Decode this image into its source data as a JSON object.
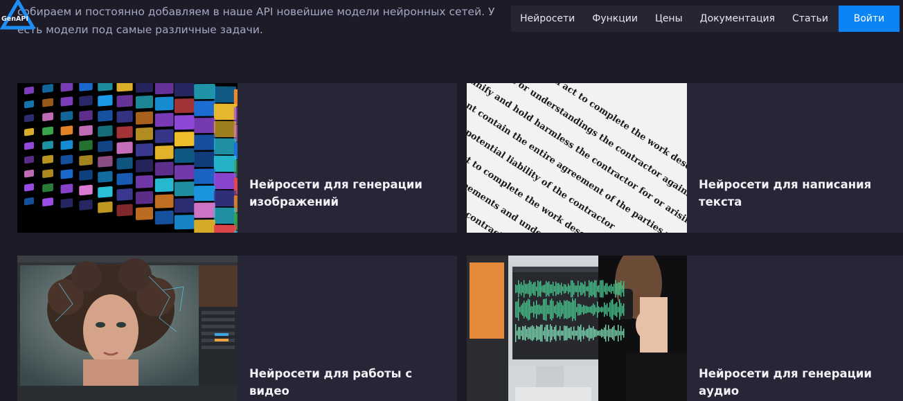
{
  "intro": {
    "line1": "собираем и постоянно добавляем в наше API новейшие модели нейронных сетей. У",
    "line2": "есть модели под самые различные задачи."
  },
  "logo": {
    "text": "GenAPI",
    "accent": "#1e8ef7"
  },
  "nav": {
    "items": [
      {
        "label": "Нейросети"
      },
      {
        "label": "Функции"
      },
      {
        "label": "Цены"
      },
      {
        "label": "Документация"
      },
      {
        "label": "Статьи"
      }
    ],
    "login_label": "Войти"
  },
  "cards": [
    {
      "title": "Нейросети для генерации изображений",
      "image": "screens-wall-image"
    },
    {
      "title": "Нейросети для написания текста",
      "image": "printed-text-image"
    },
    {
      "title": "Нейросети для работы с видео",
      "image": "portrait-editor-image"
    },
    {
      "title": "Нейросети для генерации аудио",
      "image": "audio-studio-image"
    }
  ],
  "image2_text": [
    "the parties shall act to complete the work described within",
    "agreement or understandings the contractor against loss or",
    "indemnify and hold harmless the contractor for or arising",
    "Agreement contain the entire agreement of the parties with respect",
    "of liability or potential liability of the contractor",
    "All parties shall act to complete the work described",
    "prior negotiations, agreements and understandings",
    "the entire agreement of the contractor"
  ],
  "colors": {
    "background": "#1c1b27",
    "card": "#272636",
    "nav": "#262534",
    "button": "#0b84f6"
  }
}
